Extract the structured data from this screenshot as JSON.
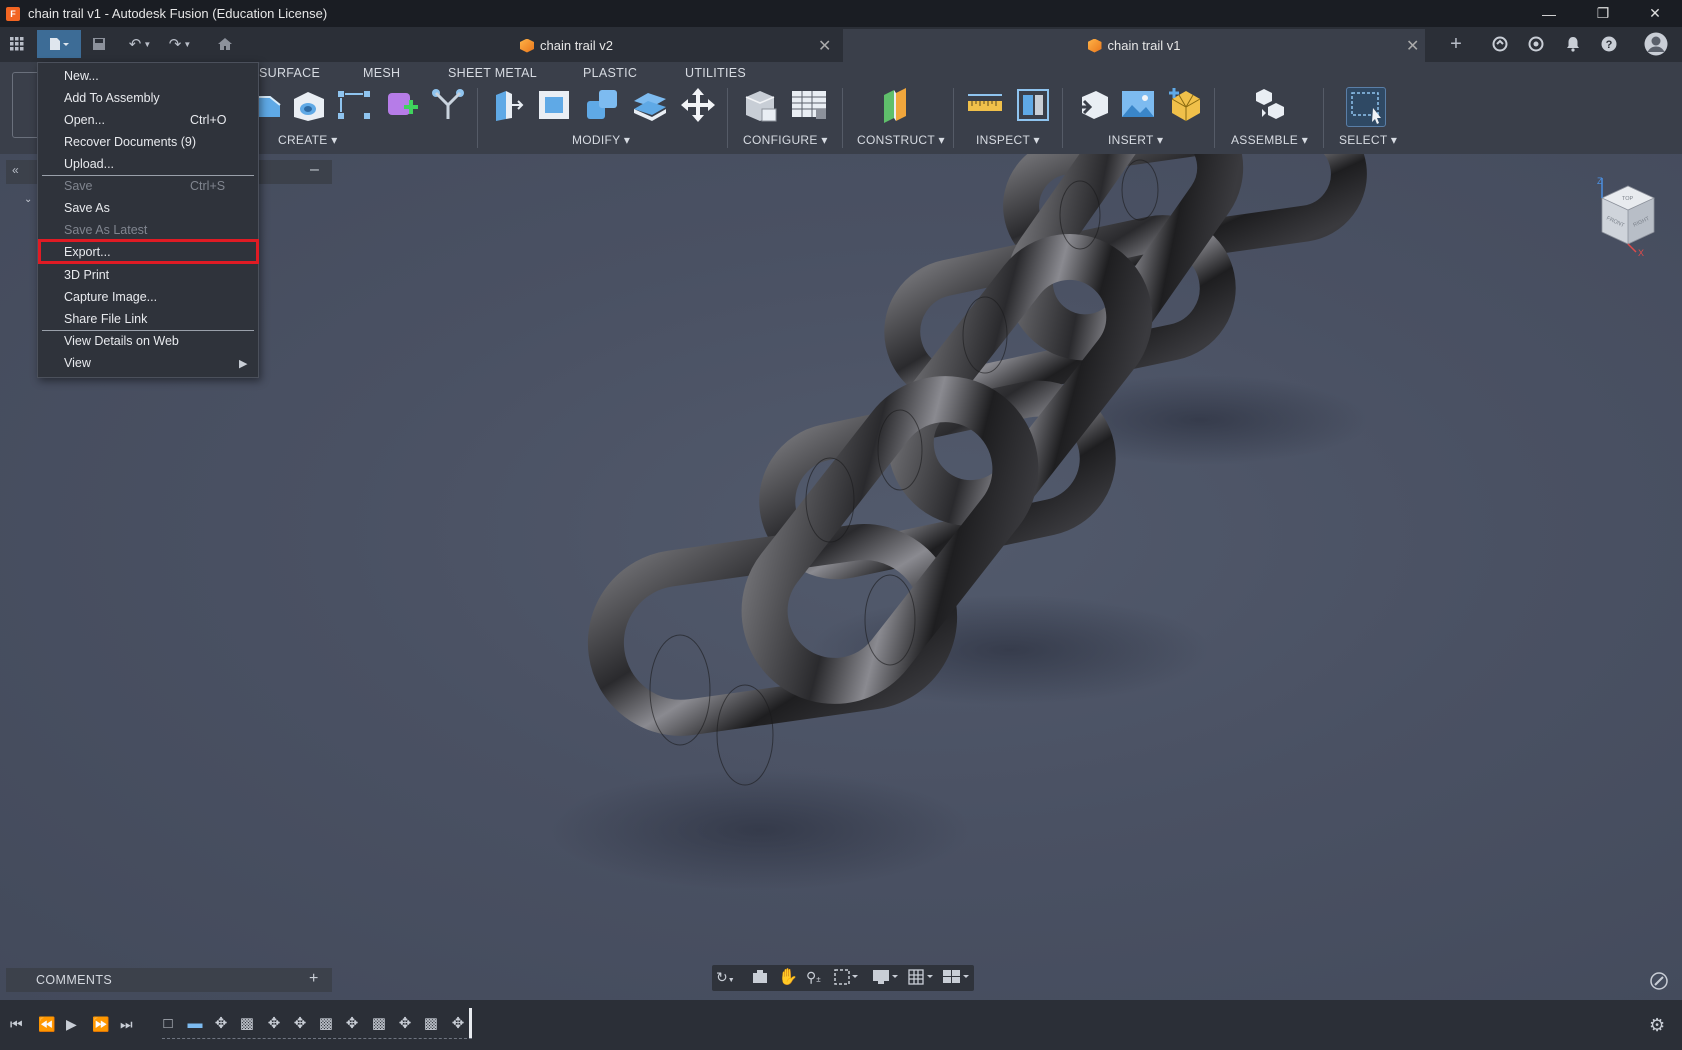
{
  "window": {
    "title": "chain trail v1 - Autodesk Fusion (Education License)",
    "logo_letter": "F"
  },
  "tabs": [
    {
      "label": "chain trail v2",
      "active": false
    },
    {
      "label": "chain trail v1",
      "active": true
    }
  ],
  "ribbon": {
    "tabs": [
      "SURFACE",
      "MESH",
      "SHEET METAL",
      "PLASTIC",
      "UTILITIES"
    ],
    "groups": [
      "CREATE",
      "MODIFY",
      "CONFIGURE",
      "CONSTRUCT",
      "INSPECT",
      "INSERT",
      "ASSEMBLE",
      "SELECT"
    ]
  },
  "file_menu": {
    "items": [
      {
        "label": "New...",
        "shortcut": "",
        "enabled": true
      },
      {
        "label": "Add To Assembly",
        "shortcut": "",
        "enabled": true
      },
      {
        "label": "Open...",
        "shortcut": "Ctrl+O",
        "enabled": true
      },
      {
        "label": "Recover Documents (9)",
        "shortcut": "",
        "enabled": true
      },
      {
        "label": "Upload...",
        "shortcut": "",
        "enabled": true
      },
      {
        "label": "Save",
        "shortcut": "Ctrl+S",
        "enabled": false
      },
      {
        "label": "Save As",
        "shortcut": "",
        "enabled": true
      },
      {
        "label": "Save As Latest",
        "shortcut": "",
        "enabled": false
      },
      {
        "label": "Export...",
        "shortcut": "",
        "enabled": true,
        "highlighted": true
      },
      {
        "label": "3D Print",
        "shortcut": "",
        "enabled": true
      },
      {
        "label": "Capture Image...",
        "shortcut": "",
        "enabled": true
      },
      {
        "label": "Share File Link",
        "shortcut": "",
        "enabled": true
      },
      {
        "label": "View Details on Web",
        "shortcut": "",
        "enabled": true
      },
      {
        "label": "View",
        "shortcut": "",
        "enabled": true,
        "submenu": true
      }
    ],
    "highlight_color": "#e01b24"
  },
  "comments": {
    "label": "COMMENTS"
  },
  "viewcube": {
    "axes": [
      "Z",
      "X"
    ],
    "faces": [
      "TOP",
      "FRONT",
      "RIGHT"
    ]
  },
  "colors": {
    "accent": "#0696d7",
    "ribbon_bg": "#3a3f4a",
    "viewport_bg": "#4b5264"
  }
}
